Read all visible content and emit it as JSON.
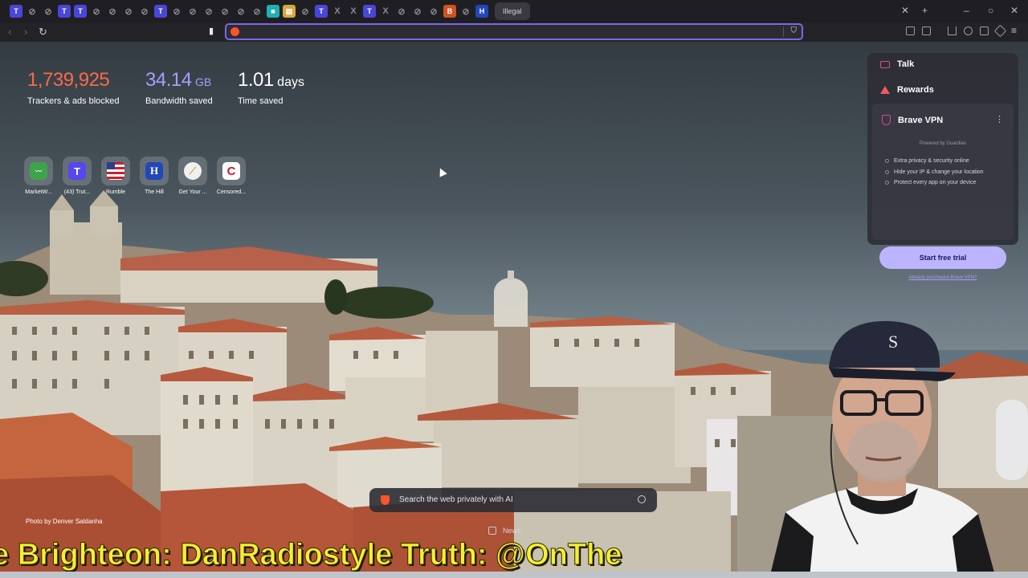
{
  "colors": {
    "accent": "#7a68e6",
    "trackers": "#fb6a48",
    "bandwidth": "#a99dff",
    "time": "#ffffff",
    "ticker": "#f5ee32",
    "trial_button": "#bcb4ff"
  },
  "tabstrip": {
    "active_tab_title": "Illegal",
    "favicon_icons": [
      "tab-t-icon",
      "tab-globe-icon",
      "tab-globe-icon",
      "tab-t-icon",
      "tab-t-icon",
      "tab-globe-icon",
      "tab-globe-icon",
      "tab-globe-icon",
      "tab-globe-icon",
      "tab-t-icon",
      "tab-globe-icon",
      "tab-globe-icon",
      "tab-globe-icon",
      "tab-globe-icon",
      "tab-globe-icon",
      "tab-globe-icon",
      "tab-square-icon",
      "tab-doc-icon",
      "tab-globe-icon",
      "tab-t-icon",
      "tab-x-icon",
      "tab-x-icon",
      "tab-t-icon",
      "tab-x-icon",
      "tab-globe-icon",
      "tab-globe-icon",
      "tab-globe-icon",
      "tab-b-icon",
      "tab-globe-icon",
      "tab-h-icon"
    ]
  },
  "stats": {
    "trackers_value": "1,739,925",
    "trackers_label": "Trackers & ads blocked",
    "bandwidth_value": "34.14",
    "bandwidth_unit": "GB",
    "bandwidth_label": "Bandwidth saved",
    "time_value": "1.01",
    "time_unit": "days",
    "time_label": "Time saved"
  },
  "shortcuts": [
    {
      "label": "MarketW...",
      "icon": "marketwatch-icon",
      "glyph": "",
      "color": "#3fa34d"
    },
    {
      "label": "(43) Trut...",
      "icon": "truth-social-icon",
      "glyph": "T",
      "color": "#5448ee"
    },
    {
      "label": "Rumble",
      "icon": "rumble-flag-icon",
      "glyph": "",
      "color": "#c8202f"
    },
    {
      "label": "The Hill",
      "icon": "the-hill-icon",
      "glyph": "H",
      "color": "#2346b8"
    },
    {
      "label": "Get Your ...",
      "icon": "get-your-icon",
      "glyph": "",
      "color": "#f0f0f0"
    },
    {
      "label": "Censored...",
      "icon": "censored-icon",
      "glyph": "C",
      "color": "#d6162b"
    }
  ],
  "panel": {
    "talk_label": "Talk",
    "rewards_label": "Rewards",
    "vpn_title": "Brave VPN",
    "powered_by": "Powered by Guardian",
    "features": [
      "Extra privacy & security online",
      "Hide your IP & change your location",
      "Protect every app on your device"
    ],
    "trial_button": "Start free trial",
    "already_purchased": "Already purchased Brave VPN?"
  },
  "search": {
    "placeholder": "Search the web privately with AI"
  },
  "news_label": "News",
  "photo_credit": "Photo by Denver Saldanha",
  "ticker_text": "e Brighteon: DanRadiostyle Truth: @OnThe"
}
